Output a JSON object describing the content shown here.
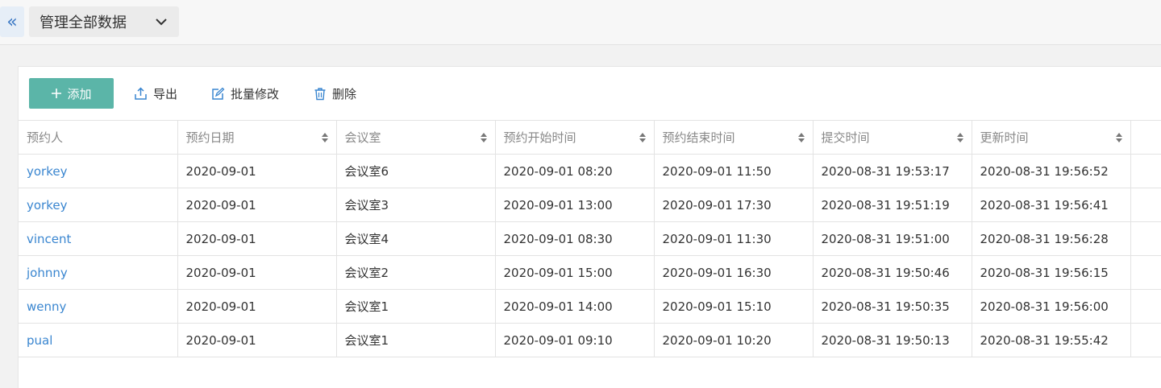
{
  "topbar": {
    "collapse_glyph": "«",
    "scope_select": {
      "value": "管理全部数据"
    }
  },
  "toolbar": {
    "add_label": "添加",
    "export_label": "导出",
    "batch_edit_label": "批量修改",
    "delete_label": "删除"
  },
  "table": {
    "columns": [
      "预约人",
      "预约日期",
      "会议室",
      "预约开始时间",
      "预约结束时间",
      "提交时间",
      "更新时间"
    ],
    "rows": [
      [
        "yorkey",
        "2020-09-01",
        "会议室6",
        "2020-09-01 08:20",
        "2020-09-01 11:50",
        "2020-08-31 19:53:17",
        "2020-08-31 19:56:52"
      ],
      [
        "yorkey",
        "2020-09-01",
        "会议室3",
        "2020-09-01 13:00",
        "2020-09-01 17:30",
        "2020-08-31 19:51:19",
        "2020-08-31 19:56:41"
      ],
      [
        "vincent",
        "2020-09-01",
        "会议室4",
        "2020-09-01 08:30",
        "2020-09-01 11:30",
        "2020-08-31 19:51:00",
        "2020-08-31 19:56:28"
      ],
      [
        "johnny",
        "2020-09-01",
        "会议室2",
        "2020-09-01 15:00",
        "2020-09-01 16:30",
        "2020-08-31 19:50:46",
        "2020-08-31 19:56:15"
      ],
      [
        "wenny",
        "2020-09-01",
        "会议室1",
        "2020-09-01 14:00",
        "2020-09-01 15:10",
        "2020-08-31 19:50:35",
        "2020-08-31 19:56:00"
      ],
      [
        "pual",
        "2020-09-01",
        "会议室1",
        "2020-09-01 09:10",
        "2020-09-01 10:20",
        "2020-08-31 19:50:13",
        "2020-08-31 19:55:42"
      ]
    ]
  },
  "colors": {
    "accent": "#5bb5a8",
    "link": "#3a86d0"
  }
}
